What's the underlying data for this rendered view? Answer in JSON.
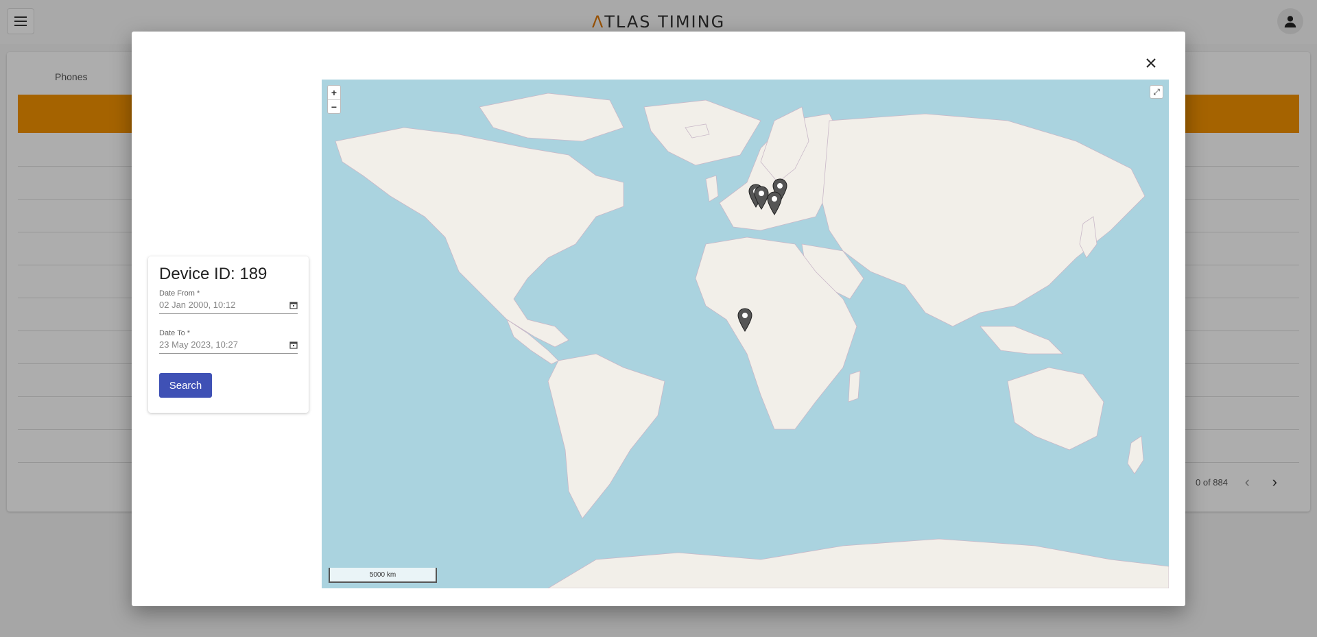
{
  "app": {
    "brand_prefix": "Λ",
    "brand_rest": "TLAS TIMING"
  },
  "background": {
    "tab_label": "Phones",
    "paging_text": "0 of 884",
    "accent_color": "#f39200"
  },
  "modal": {
    "device_title": "Device ID: 189",
    "date_from": {
      "label": "Date From *",
      "value": "02 Jan 2000, 10:12"
    },
    "date_to": {
      "label": "Date To *",
      "value": "23 May 2023, 10:27"
    },
    "search_label": "Search",
    "primary_color": "#3f51b5"
  },
  "map": {
    "zoom_in": "+",
    "zoom_out": "−",
    "fullscreen": "⤢",
    "scale_label": "5000 km",
    "markers": [
      {
        "name": "marker-france"
      },
      {
        "name": "marker-switzerland"
      },
      {
        "name": "marker-germany"
      },
      {
        "name": "marker-italy"
      },
      {
        "name": "marker-west-africa"
      }
    ]
  }
}
